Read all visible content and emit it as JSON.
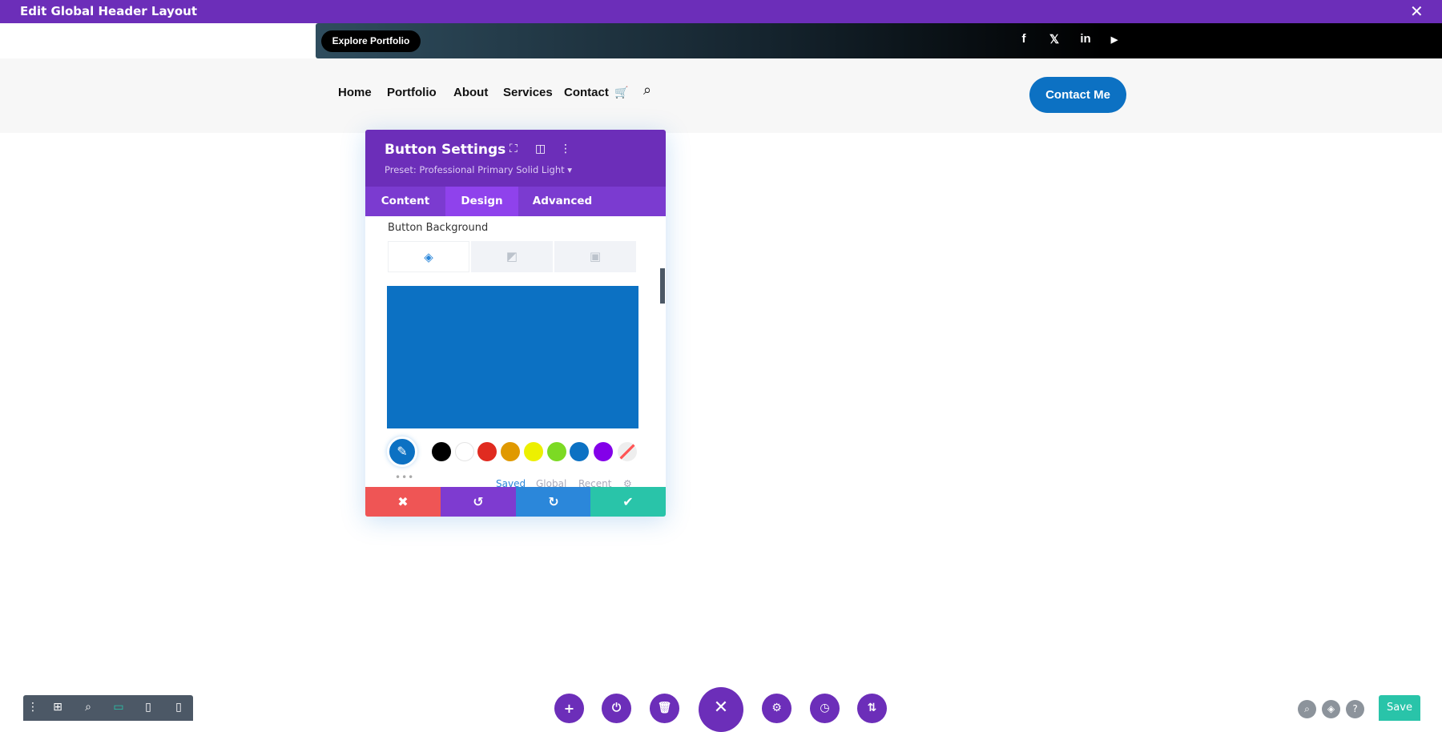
{
  "window": {
    "title": "Edit Global Header Layout",
    "close_icon": "close-icon"
  },
  "header": {
    "explore_button": "Explore Portfolio",
    "social": [
      "f",
      "𝕏",
      "in",
      "▶"
    ],
    "nav": [
      "Home",
      "Portfolio",
      "About",
      "Services",
      "Contact"
    ],
    "cart_icon": "🛒",
    "search_icon": "⌕",
    "cta": "Contact Me"
  },
  "panel": {
    "title": "Button Settings",
    "preset": "Preset: Professional Primary Solid Light ▾",
    "tabs": [
      "Content",
      "Design",
      "Advanced"
    ],
    "active_tab": "Design",
    "section_label": "Button Background",
    "bg_tabs": [
      "color",
      "gradient",
      "image"
    ],
    "selected_color": "#0c71c3",
    "swatches": [
      "#000000",
      "#ffffff",
      "#e02b20",
      "#e09900",
      "#edf000",
      "#7cda24",
      "#0c71c3",
      "#8300e9",
      "none"
    ],
    "palette_tabs": [
      "Saved",
      "Global",
      "Recent"
    ],
    "dots": "•••",
    "footer": {
      "cancel": "✖",
      "undo": "↺",
      "redo": "↻",
      "confirm": "✔"
    }
  },
  "bottom": {
    "save": "Save"
  },
  "colors": {
    "purple": "#6c2eb9",
    "blue": "#0c71c3",
    "red": "#ef5555",
    "teal": "#29c4a9",
    "bluebtn": "#2b87da"
  }
}
